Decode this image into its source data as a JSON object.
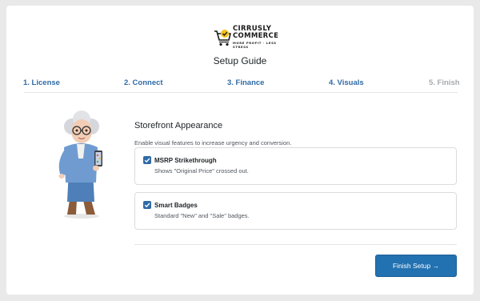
{
  "brand": {
    "line1": "CIRRUSLY",
    "line2": "COMMERCE",
    "tagline": "MORE PROFIT · LESS STRESS",
    "accent_color": "#f3c01c"
  },
  "page_title": "Setup Guide",
  "steps": [
    {
      "label": "1. License",
      "state": "active"
    },
    {
      "label": "2. Connect",
      "state": "active"
    },
    {
      "label": "3. Finance",
      "state": "active"
    },
    {
      "label": "4. Visuals",
      "state": "active"
    },
    {
      "label": "5. Finish",
      "state": "inactive"
    }
  ],
  "colors": {
    "primary": "#2271b1",
    "step_active": "#2f6aa6",
    "step_inactive": "#a7aaad"
  },
  "section": {
    "title": "Storefront Appearance",
    "description": "Enable visual features to increase urgency and conversion."
  },
  "options": [
    {
      "title": "MSRP Strikethrough",
      "description": "Shows \"Original Price\" crossed out.",
      "checked": true
    },
    {
      "title": "Smart Badges",
      "description": "Standard \"New\" and \"Sale\" badges.",
      "checked": true
    }
  ],
  "finish_button": "Finish Setup →"
}
